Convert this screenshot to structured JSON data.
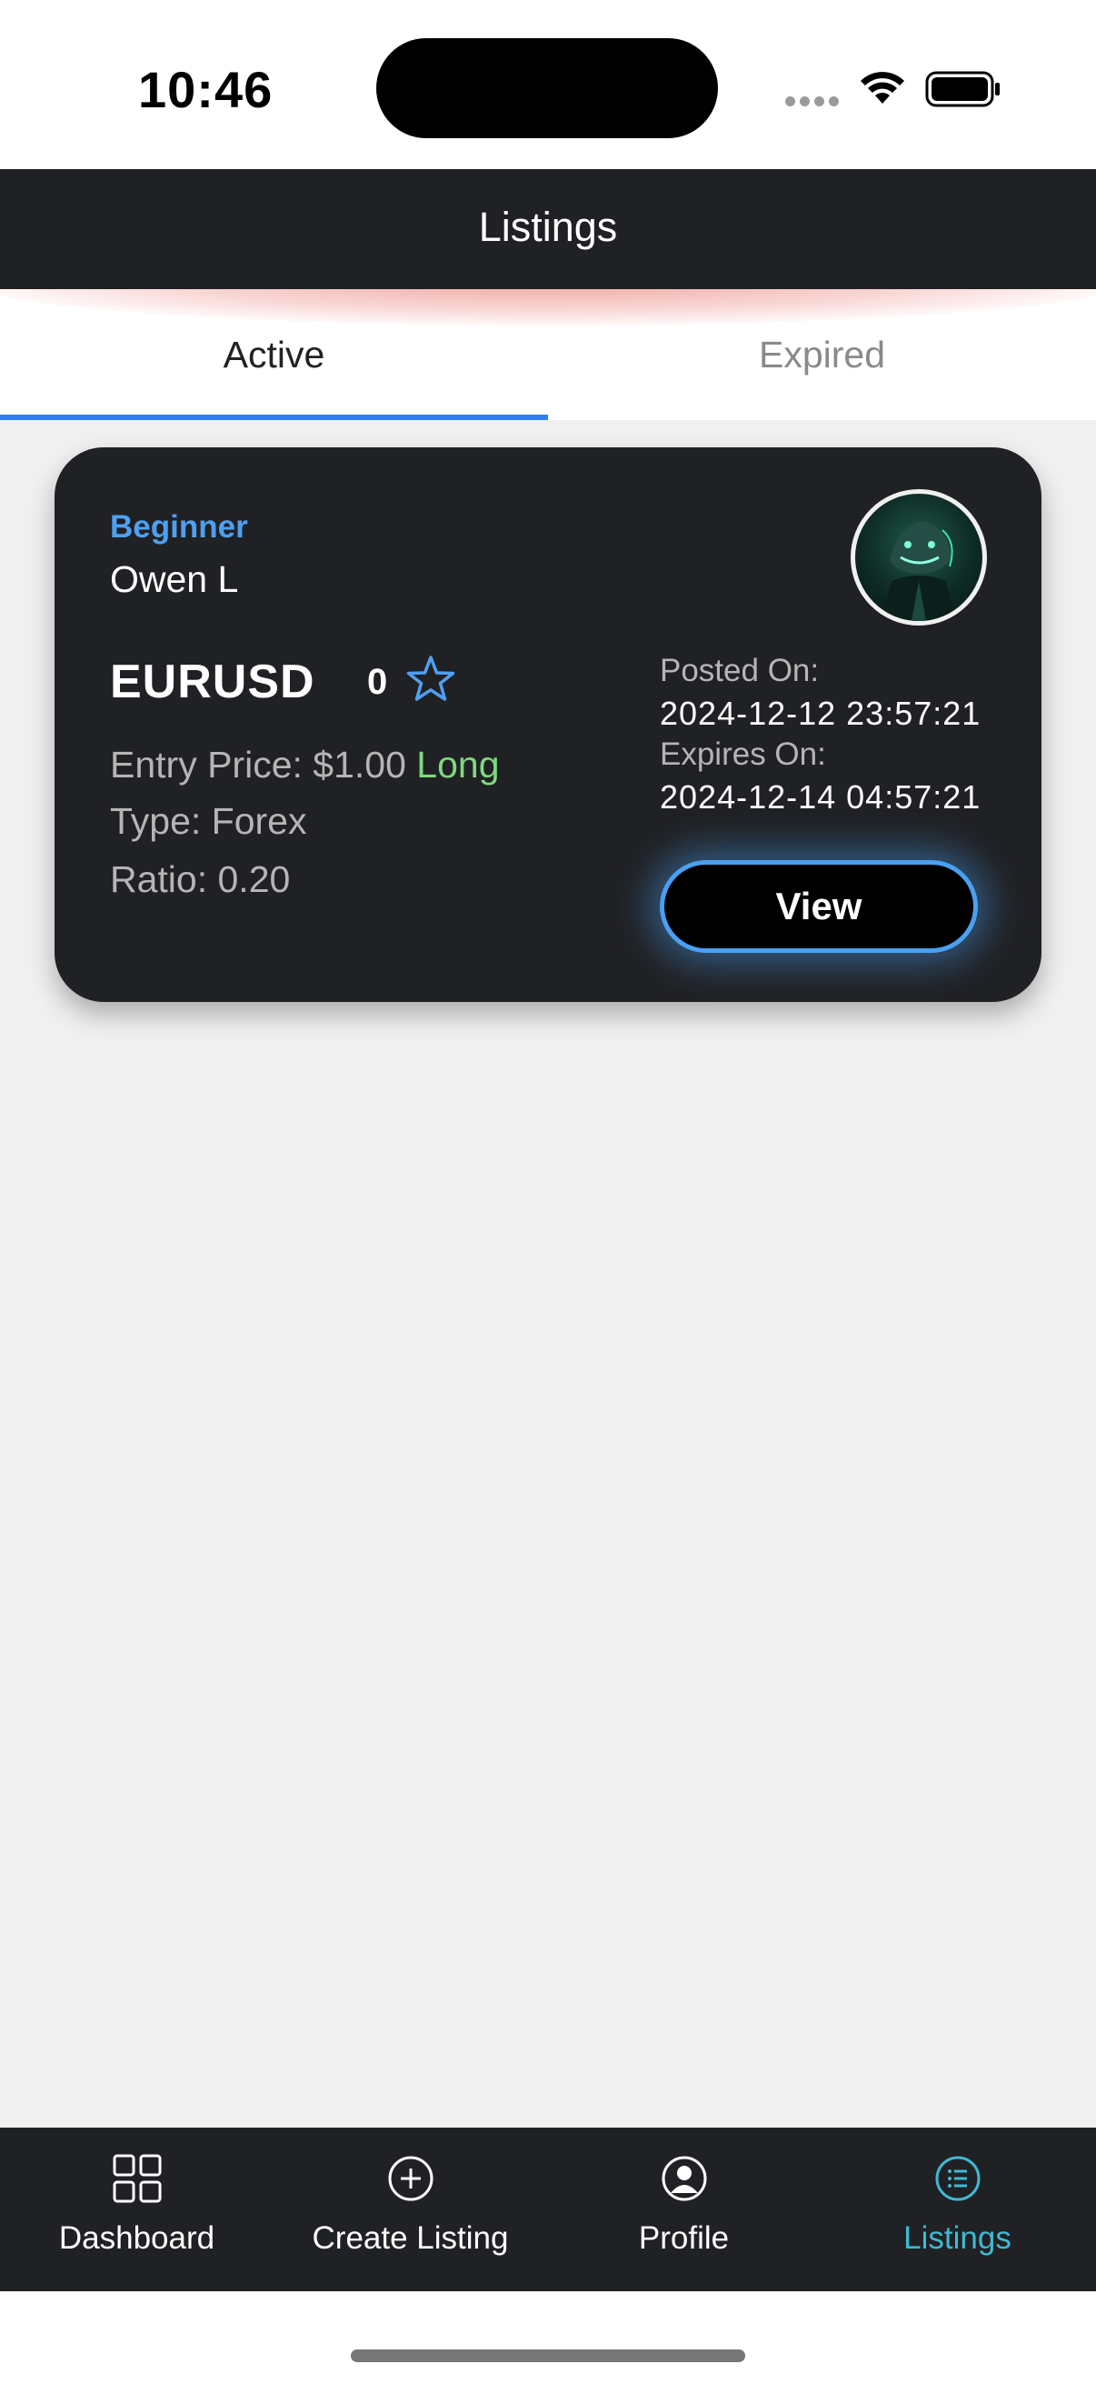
{
  "status_bar": {
    "time": "10:46"
  },
  "header": {
    "title": "Listings"
  },
  "tabs": [
    {
      "label": "Active",
      "selected": true
    },
    {
      "label": "Expired",
      "selected": false
    }
  ],
  "listing": {
    "level": "Beginner",
    "trader": "Owen L",
    "symbol": "EURUSD",
    "rating_count": "0",
    "entry_label": "Entry Price: $1.00",
    "direction": "Long",
    "type_label": "Type: Forex",
    "ratio_label": "Ratio: 0.20",
    "posted_label": "Posted On:",
    "posted_value": "2024-12-12 23:57:21",
    "expires_label": "Expires On:",
    "expires_value": "2024-12-14 04:57:21",
    "view_label": "View",
    "avatar_icon": "shark-avatar-icon"
  },
  "bottom_nav": [
    {
      "label": "Dashboard",
      "icon": "grid-icon",
      "active": false
    },
    {
      "label": "Create Listing",
      "icon": "plus-circle-icon",
      "active": false
    },
    {
      "label": "Profile",
      "icon": "user-circle-icon",
      "active": false
    },
    {
      "label": "Listings",
      "icon": "list-circle-icon",
      "active": true
    }
  ],
  "colors": {
    "accent_blue": "#2f80e8",
    "level_blue": "#4ea0f2",
    "long_green": "#7fd97f",
    "nav_active": "#3fb9d4",
    "card_bg": "#202124"
  }
}
